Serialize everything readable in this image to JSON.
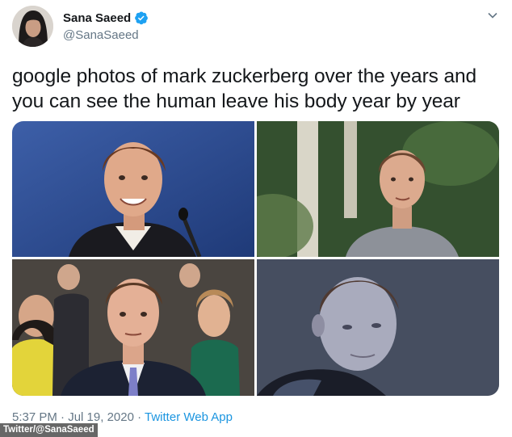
{
  "author": {
    "display_name": "Sana Saeed",
    "handle": "@SanaSaeed",
    "verified": true
  },
  "tweet": {
    "text_line1": "google photos of mark zuckerberg over the years and",
    "text_line2": "you can see the human leave his body year by year",
    "photos": [
      {
        "label": "photo-1"
      },
      {
        "label": "photo-2"
      },
      {
        "label": "photo-3"
      },
      {
        "label": "photo-4"
      }
    ]
  },
  "footer": {
    "time": "5:37 PM",
    "separator": " · ",
    "date": "Jul 19, 2020",
    "source": "Twitter Web App"
  },
  "watermark": "Twitter/@SanaSaeed",
  "colors": {
    "verified_blue": "#1da1f2",
    "link_blue": "#1b95e0",
    "secondary_text": "#657786",
    "primary_text": "#14171a"
  },
  "icons": [
    "verified-badge-icon",
    "chevron-down-icon"
  ]
}
